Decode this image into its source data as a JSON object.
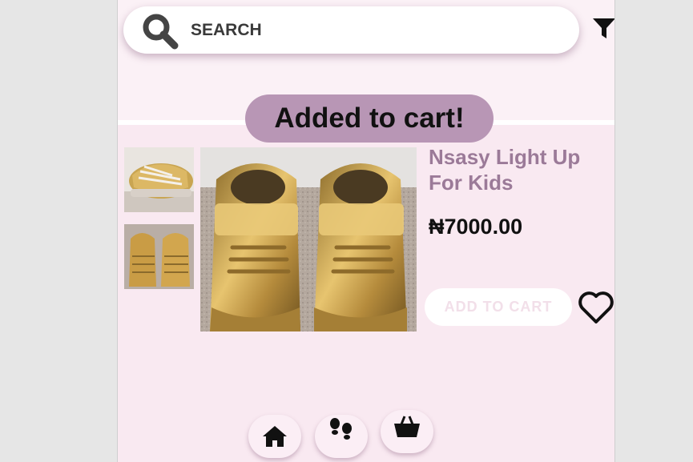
{
  "search": {
    "placeholder": "SEARCH"
  },
  "toast": {
    "message": "Added to cart!"
  },
  "product": {
    "title": "Nsasy Light Up For Kids",
    "price": "₦7000.00",
    "add_to_cart_label": "ADD TO CART"
  },
  "icons": {
    "search": "search-icon",
    "filter": "filter-icon",
    "favorite": "heart-icon",
    "home": "home-icon",
    "shoes": "footprints-icon",
    "cart": "basket-icon"
  },
  "colors": {
    "background": "#f9e9f1",
    "toast": "#b896b5",
    "title": "#9b7a98",
    "add_to_cart_text": "#f2dfe9"
  }
}
